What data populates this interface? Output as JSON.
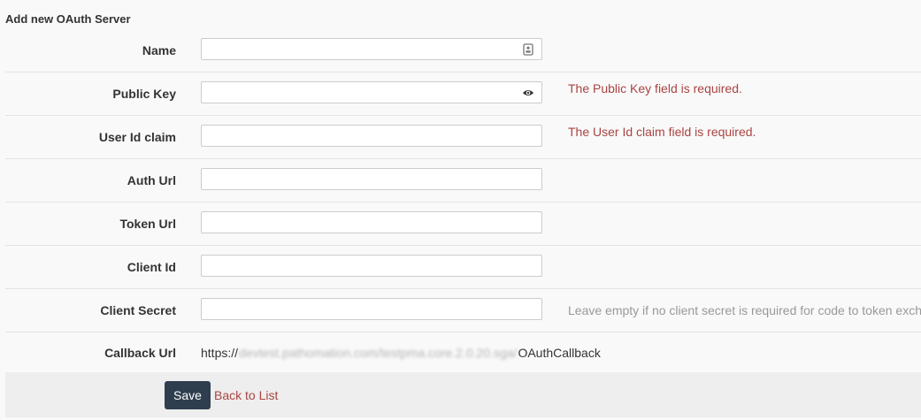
{
  "page_title": "Add new OAuth Server",
  "fields": [
    {
      "label": "Name",
      "value": "",
      "icon": "contact-card-icon",
      "error": ""
    },
    {
      "label": "Public Key",
      "value": "",
      "icon": "eye-icon",
      "error": "The Public Key field is required."
    },
    {
      "label": "User Id claim",
      "value": "",
      "icon": "",
      "error": "The User Id claim field is required."
    },
    {
      "label": "Auth Url",
      "value": "",
      "icon": "",
      "error": ""
    },
    {
      "label": "Token Url",
      "value": "",
      "icon": "",
      "error": ""
    },
    {
      "label": "Client Id",
      "value": "",
      "icon": "",
      "error": ""
    },
    {
      "label": "Client Secret",
      "value": "",
      "icon": "",
      "hint": "Leave empty if no client secret is required for code to token exchange"
    }
  ],
  "callback": {
    "label": "Callback Url",
    "prefix": "https://",
    "blurred_part": "devtest.pathomation.com/testpma.core.2.0.20.sga/",
    "suffix": "OAuthCallback"
  },
  "actions": {
    "save_label": "Save",
    "back_label": "Back to List"
  },
  "colors": {
    "error": "#a94442",
    "hint": "#999999",
    "save_button": "#2f3e4e"
  }
}
